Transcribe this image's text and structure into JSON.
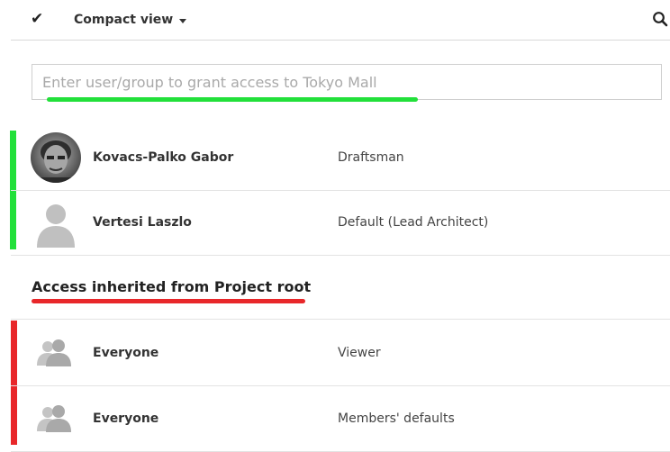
{
  "toolbar": {
    "view_label": "Compact view",
    "icons": {
      "check": "check-icon",
      "caret": "chevron-down-icon",
      "search": "search-icon"
    }
  },
  "grant": {
    "placeholder": "Enter user/group to grant access to Tokyo Mall",
    "value": ""
  },
  "direct_access": [
    {
      "name": "Kovacs-Palko Gabor",
      "role": "Draftsman",
      "avatar": "user-photo"
    },
    {
      "name": "Vertesi Laszlo",
      "role": "Default  (Lead Architect)",
      "avatar": "default-avatar-icon"
    }
  ],
  "inherited": {
    "title": "Access inherited from Project root",
    "entries": [
      {
        "name": "Everyone",
        "role": "Viewer",
        "icon": "group-icon"
      },
      {
        "name": "Everyone",
        "role": "Members' defaults",
        "icon": "group-icon"
      }
    ]
  },
  "colors": {
    "direct_marker": "#22e03a",
    "inherited_marker": "#e8272a",
    "border": "#e3e3e3",
    "placeholder": "#a9a9a9"
  }
}
